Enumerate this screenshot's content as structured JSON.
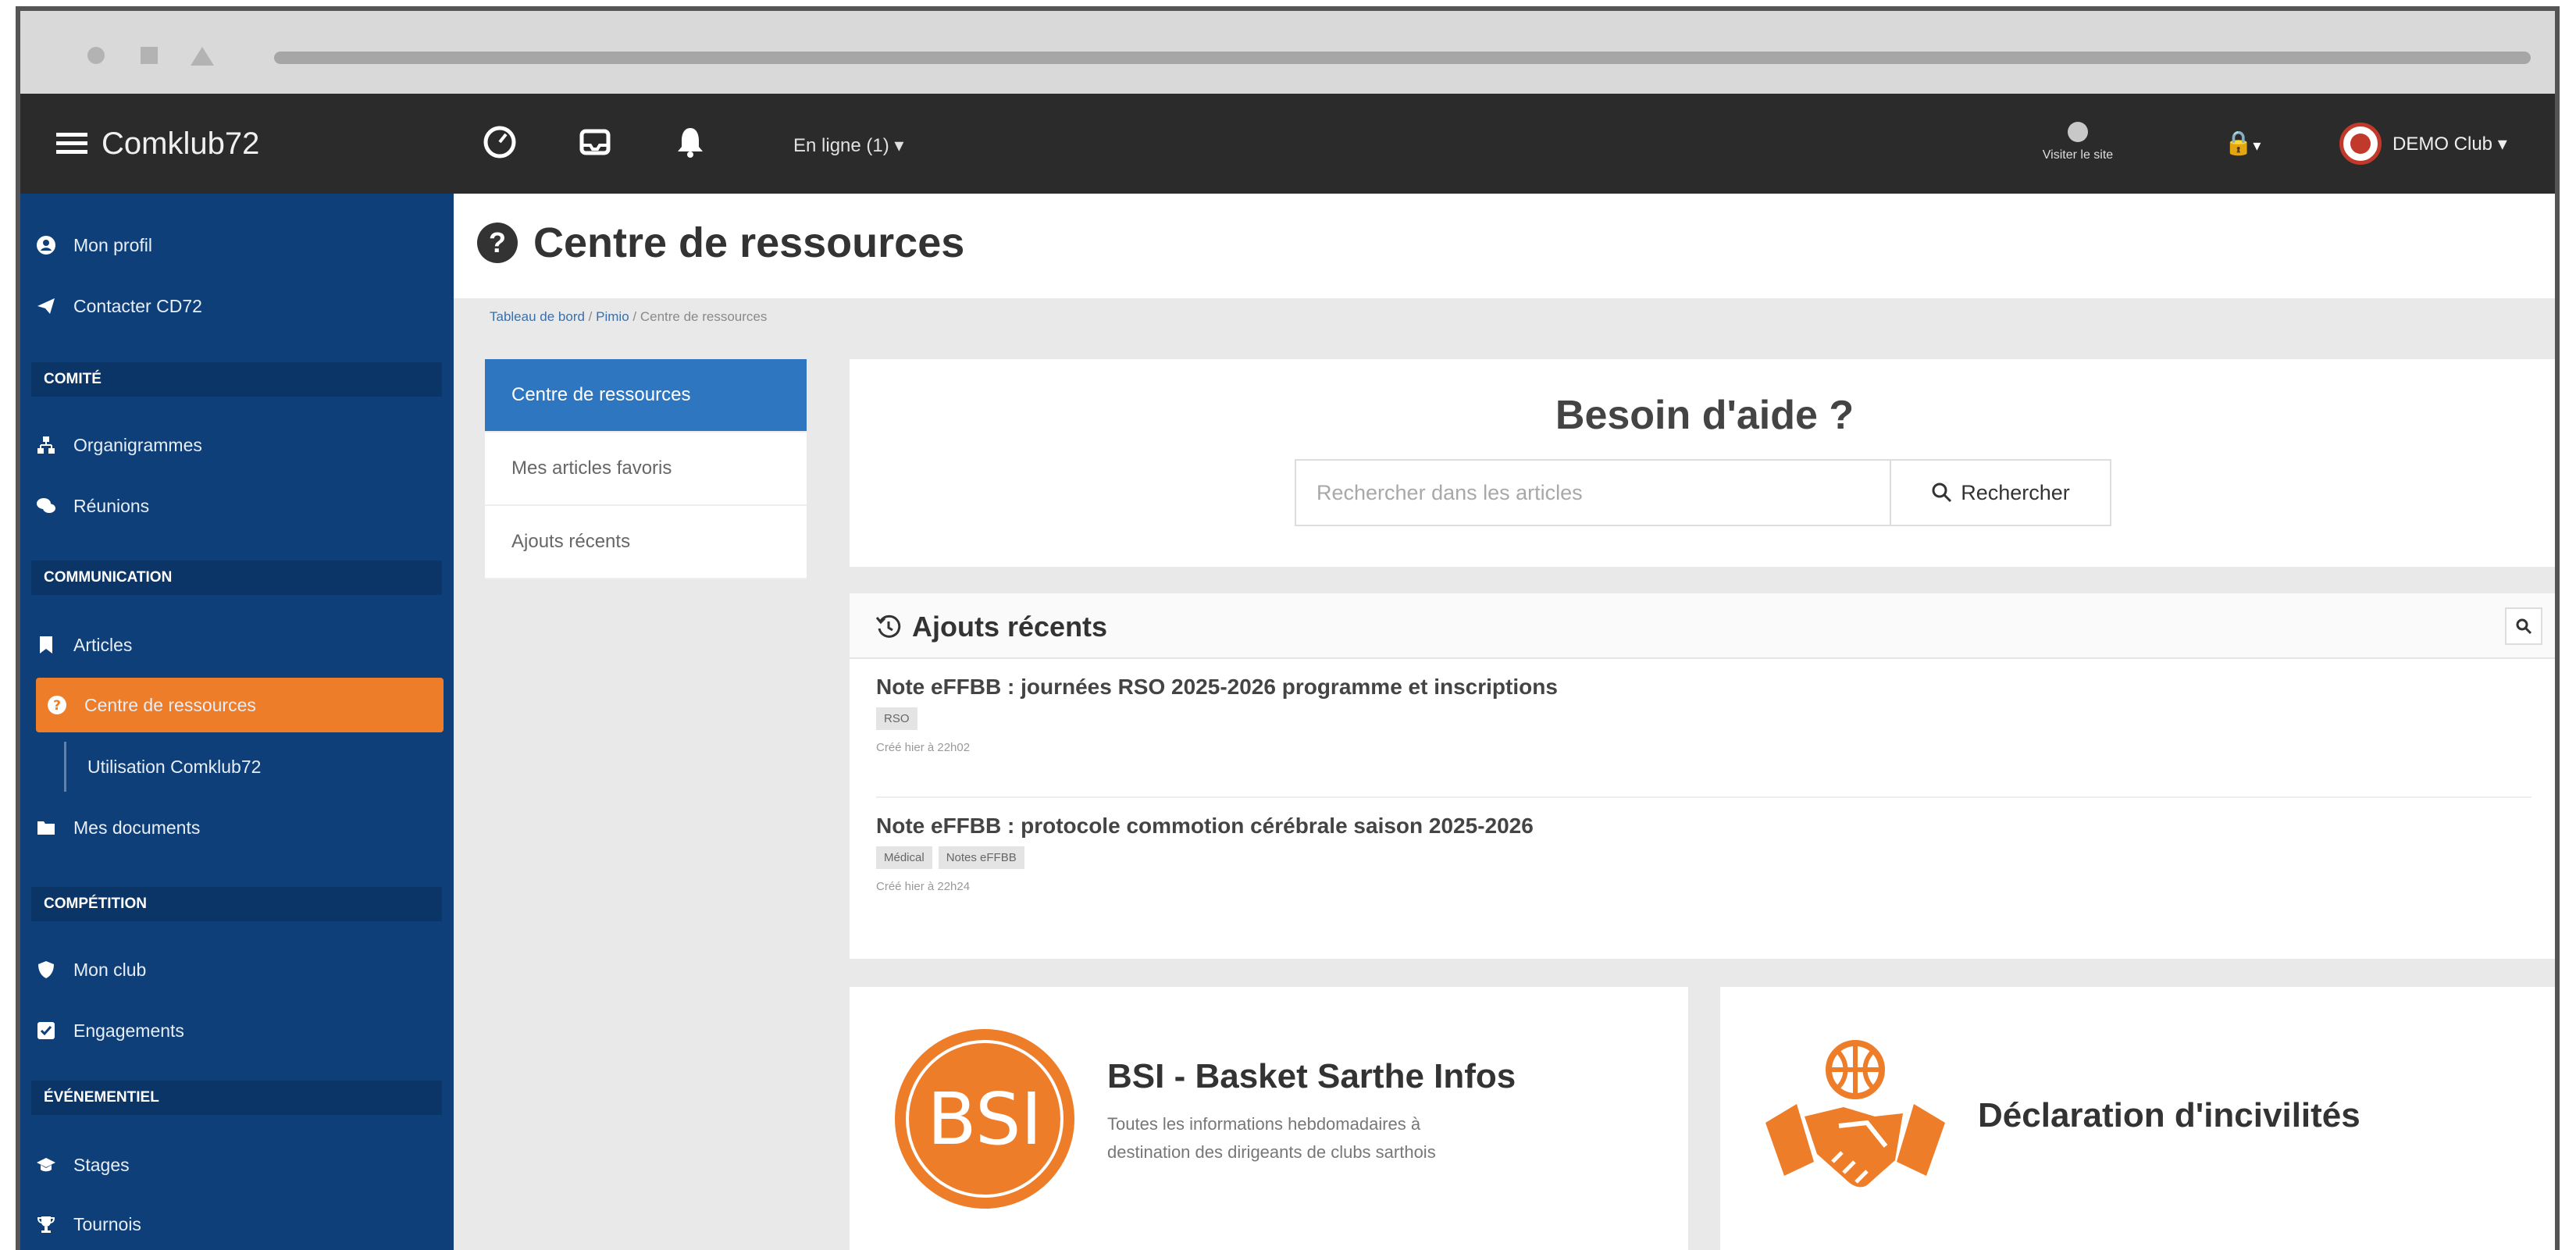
{
  "app": {
    "name": "Comklub72",
    "online_label": "En ligne (1) ▾",
    "visit_site_label": "Visiter le site",
    "lock_label": "▾",
    "user_name": "DEMO Club ▾"
  },
  "sidebar": {
    "items_top": [
      {
        "label": "Mon profil",
        "icon": "user-circle-icon"
      },
      {
        "label": "Contacter CD72",
        "icon": "paper-plane-icon"
      }
    ],
    "sections": [
      {
        "title": "COMITÉ",
        "items": [
          {
            "label": "Organigrammes",
            "icon": "sitemap-icon"
          },
          {
            "label": "Réunions",
            "icon": "comments-icon"
          }
        ]
      },
      {
        "title": "COMMUNICATION",
        "items": [
          {
            "label": "Articles",
            "icon": "bookmark-icon"
          },
          {
            "label": "Centre de ressources",
            "icon": "question-circle-icon",
            "active": true
          },
          {
            "label": "Utilisation Comklub72",
            "sub": true
          },
          {
            "label": "Mes documents",
            "icon": "folder-icon"
          }
        ]
      },
      {
        "title": "COMPÉTITION",
        "items": [
          {
            "label": "Mon club",
            "icon": "shield-icon"
          },
          {
            "label": "Engagements",
            "icon": "check-square-icon"
          }
        ]
      },
      {
        "title": "ÉVÉNEMENTIEL",
        "items": [
          {
            "label": "Stages",
            "icon": "graduation-cap-icon"
          },
          {
            "label": "Tournois",
            "icon": "trophy-icon"
          }
        ]
      }
    ]
  },
  "page": {
    "title": "Centre de ressources",
    "breadcrumb": {
      "item1": "Tableau de bord",
      "sep": "/",
      "item2": "Pimio",
      "item3": "Centre de ressources"
    }
  },
  "side_nav": {
    "items": [
      "Centre de ressources",
      "Mes articles favoris",
      "Ajouts récents"
    ]
  },
  "help": {
    "title": "Besoin d'aide ?",
    "search_placeholder": "Rechercher dans les articles",
    "search_button": "Rechercher"
  },
  "recent": {
    "title": "Ajouts récents",
    "articles": [
      {
        "title": "Note eFFBB : journées RSO 2025-2026 programme et inscriptions",
        "tags": [
          "RSO"
        ],
        "date": "Créé hier à 22h02"
      },
      {
        "title": "Note eFFBB : protocole commotion cérébrale saison 2025-2026",
        "tags": [
          "Médical",
          "Notes eFFBB"
        ],
        "date": "Créé hier à 22h24"
      }
    ]
  },
  "cards": {
    "bsi": {
      "logo_text": "BSI",
      "title": "BSI - Basket Sarthe Infos",
      "desc_line1": "Toutes les informations hebdomadaires à",
      "desc_line2": "destination des dirigeants de clubs sarthois"
    },
    "incivilites": {
      "title": "Déclaration d'incivilités"
    }
  },
  "colors": {
    "sidebar": "#0e3f78",
    "accent": "#ee7d2a",
    "topbar": "#2b2b2b",
    "active_nav": "#2f76c1"
  }
}
